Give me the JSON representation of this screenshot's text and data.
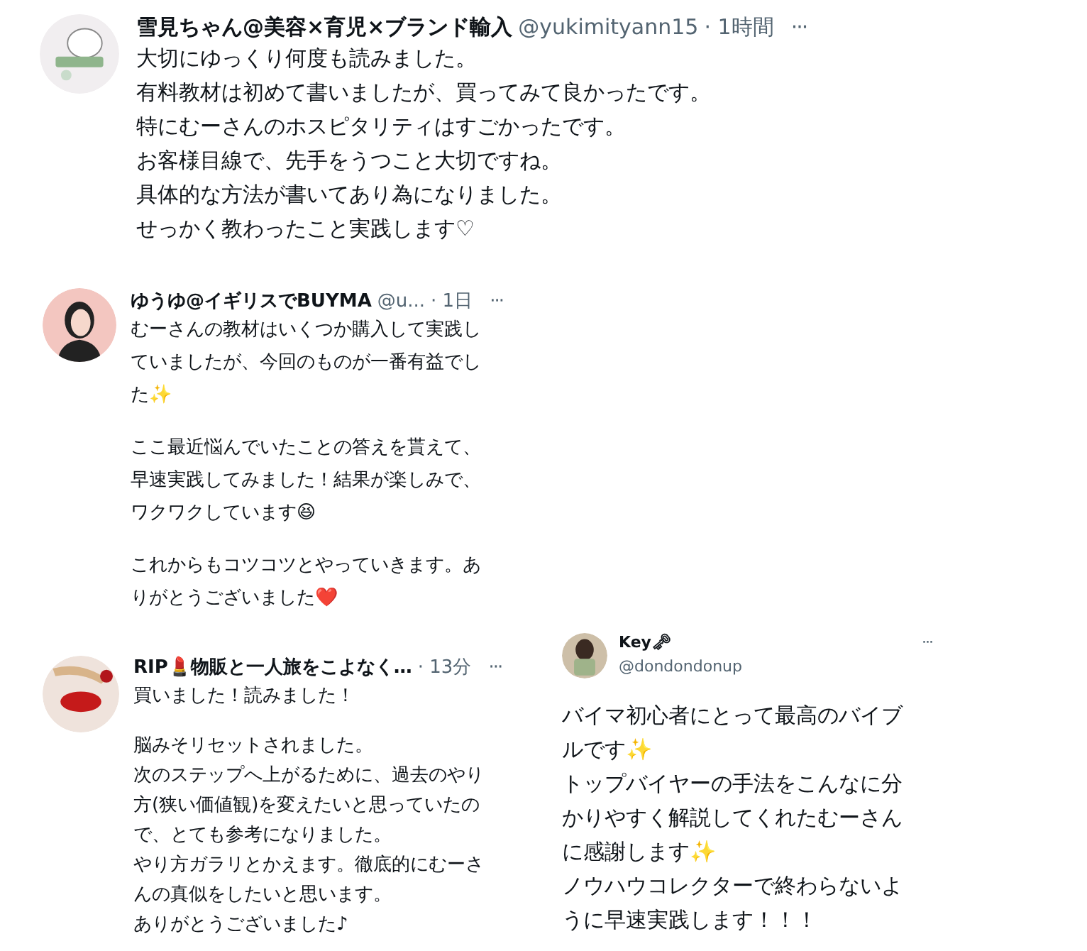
{
  "tweets": [
    {
      "display_name": "雪見ちゃん@美容×育児×ブランド輸入",
      "handle": "@yukimityann15",
      "time": "· 1時間",
      "more": "···",
      "paragraphs": [
        [
          "大切にゆっくり何度も読みました。",
          "有料教材は初めて書いましたが、買ってみて良かったです。",
          "特にむーさんのホスピタリティはすごかったです。",
          "お客様目線で、先手をうつこと大切ですね。",
          "具体的な方法が書いてあり為になりました。",
          "せっかく教わったこと実践します♡"
        ]
      ]
    },
    {
      "display_name": "ゆうゆ@イギリスでBUYMA",
      "handle": "@u...",
      "time": "· 1日",
      "more": "···",
      "paragraphs": [
        [
          "むーさんの教材はいくつか購入して実践し",
          "ていましたが、今回のものが一番有益でし",
          "た✨"
        ],
        [
          "ここ最近悩んでいたことの答えを貰えて、",
          "早速実践してみました！結果が楽しみで、",
          "ワクワクしています😆"
        ],
        [
          "これからもコツコツとやっていきます。あ",
          "りがとうございました❤️"
        ]
      ]
    },
    {
      "display_name": "RIP💄物販と一人旅をこよなく…",
      "time": "· 13分",
      "more": "···",
      "paragraphs": [
        [
          "買いました！読みました！"
        ],
        [
          "脳みそリセットされました。",
          "次のステップへ上がるために、過去のやり",
          "方(狭い価値観)を変えたいと思っていたの",
          "で、とても参考になりました。",
          "やり方ガラリとかえます。徹底的にむーさ",
          "んの真似をしたいと思います。",
          "ありがとうございました♪"
        ]
      ]
    },
    {
      "display_name": "Key🗝",
      "handle": "@dondondonup",
      "more": "···",
      "paragraphs": [
        [
          "バイマ初心者にとって最高のバイブ",
          "ルです✨",
          "トップバイヤーの手法をこんなに分",
          "かりやすく解説してくれたむーさん",
          "に感謝します✨",
          "ノウハウコレクターで終わらないよ",
          "うに早速実践します！！！"
        ]
      ]
    }
  ]
}
